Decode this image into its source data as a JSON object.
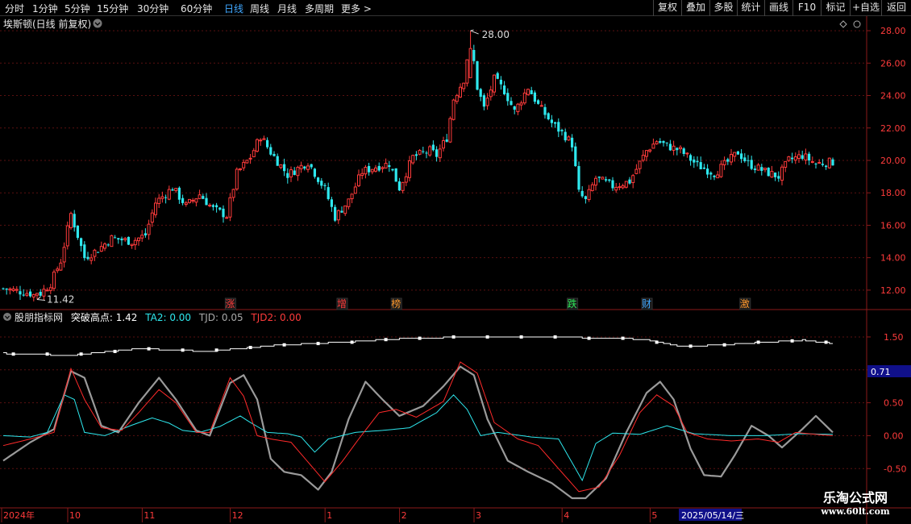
{
  "toolbar": {
    "timeframes": [
      "分时",
      "1分钟",
      "5分钟",
      "15分钟",
      "30分钟",
      "60分钟",
      "日线",
      "周线",
      "月线",
      "多周期",
      "更多 >"
    ],
    "active_timeframe": "日线",
    "right_buttons": [
      "复权",
      "叠加",
      "多股",
      "统计",
      "画线",
      "F10",
      "标记",
      "+自选",
      "返回"
    ]
  },
  "main_panel": {
    "title": "埃斯顿(日线 前复权)",
    "y_ticks": [
      "28.00",
      "26.00",
      "24.00",
      "22.00",
      "20.00",
      "18.00",
      "16.00",
      "14.00",
      "12.00"
    ],
    "high_label": "28.00",
    "low_label": "11.42",
    "event_markers": [
      {
        "text": "涨",
        "color": "#ff3b3b",
        "index": 67
      },
      {
        "text": "增",
        "color": "#ff3b3b",
        "index": 100
      },
      {
        "text": "榜",
        "color": "#ff9a2e",
        "index": 116
      },
      {
        "text": "跌",
        "color": "#2ee85a",
        "index": 168
      },
      {
        "text": "财",
        "color": "#3fa7ff",
        "index": 190
      },
      {
        "text": "激",
        "color": "#ff9a2e",
        "index": 219
      }
    ]
  },
  "indicator_panel": {
    "name": "股朋指标网",
    "legend": [
      {
        "label": "突破高点: 1.42",
        "color": "#ffffff"
      },
      {
        "label": "TA2: 0.00",
        "color": "#2ee8ee"
      },
      {
        "label": "TJD: 0.05",
        "color": "#aaaaaa"
      },
      {
        "label": "TJD2: 0.00",
        "color": "#ff3b3b"
      }
    ],
    "y_ticks": [
      "1.50",
      "1.00",
      "0.50",
      "0.00",
      "-0.50"
    ],
    "current_value": "0.71"
  },
  "x_axis": {
    "labels": [
      {
        "text": "2024年",
        "index": 0
      },
      {
        "text": "10",
        "index": 20
      },
      {
        "text": "11",
        "index": 42
      },
      {
        "text": "12",
        "index": 68
      },
      {
        "text": "1",
        "index": 96
      },
      {
        "text": "2",
        "index": 118
      },
      {
        "text": "3",
        "index": 140
      },
      {
        "text": "4",
        "index": 166
      },
      {
        "text": "5",
        "index": 192
      }
    ],
    "selected_date": "2025/05/14/三"
  },
  "watermark": {
    "line1": "乐淘公式网",
    "line2": "www.60lt.com"
  },
  "chart_data": {
    "type": "candlestick",
    "title": "埃斯顿(日线 前复权)",
    "price_range": [
      11.0,
      28.6
    ],
    "highest": 28.0,
    "lowest": 11.42,
    "close_keypoints": [
      [
        0,
        12.1
      ],
      [
        8,
        11.8
      ],
      [
        10,
        11.6
      ],
      [
        14,
        12.4
      ],
      [
        17,
        13.8
      ],
      [
        20,
        16.7
      ],
      [
        24,
        14.0
      ],
      [
        28,
        14.5
      ],
      [
        32,
        15.2
      ],
      [
        38,
        15.0
      ],
      [
        42,
        15.4
      ],
      [
        45,
        17.4
      ],
      [
        50,
        18.3
      ],
      [
        54,
        17.2
      ],
      [
        58,
        17.9
      ],
      [
        62,
        17.0
      ],
      [
        66,
        16.6
      ],
      [
        69,
        19.2
      ],
      [
        73,
        20.2
      ],
      [
        76,
        21.5
      ],
      [
        79,
        20.5
      ],
      [
        84,
        19.1
      ],
      [
        90,
        19.9
      ],
      [
        95,
        18.2
      ],
      [
        98,
        16.5
      ],
      [
        102,
        17.5
      ],
      [
        106,
        19.3
      ],
      [
        110,
        19.6
      ],
      [
        114,
        19.8
      ],
      [
        117,
        18.3
      ],
      [
        121,
        20.2
      ],
      [
        126,
        20.6
      ],
      [
        128,
        20.3
      ],
      [
        131,
        21.4
      ],
      [
        133,
        23.8
      ],
      [
        136,
        25.0
      ],
      [
        138,
        27.6
      ],
      [
        140,
        24.5
      ],
      [
        142,
        23.2
      ],
      [
        145,
        25.0
      ],
      [
        148,
        24.3
      ],
      [
        151,
        23.0
      ],
      [
        155,
        24.5
      ],
      [
        158,
        23.4
      ],
      [
        162,
        22.3
      ],
      [
        166,
        21.5
      ],
      [
        168,
        21.0
      ],
      [
        170,
        18.0
      ],
      [
        172,
        17.5
      ],
      [
        175,
        18.9
      ],
      [
        180,
        18.4
      ],
      [
        185,
        18.7
      ],
      [
        190,
        20.6
      ],
      [
        193,
        21.2
      ],
      [
        196,
        20.9
      ],
      [
        200,
        20.6
      ],
      [
        205,
        19.7
      ],
      [
        210,
        19.2
      ],
      [
        214,
        19.9
      ],
      [
        217,
        20.5
      ],
      [
        220,
        19.8
      ],
      [
        225,
        19.3
      ],
      [
        229,
        19.0
      ],
      [
        232,
        20.0
      ],
      [
        236,
        20.3
      ],
      [
        240,
        19.8
      ],
      [
        245,
        19.9
      ]
    ],
    "indicator": {
      "range": [
        -0.95,
        1.72
      ],
      "breakout_high_line": [
        [
          0,
          1.25
        ],
        [
          20,
          1.22
        ],
        [
          40,
          1.32
        ],
        [
          60,
          1.28
        ],
        [
          80,
          1.37
        ],
        [
          100,
          1.42
        ],
        [
          120,
          1.48
        ],
        [
          140,
          1.5
        ],
        [
          160,
          1.5
        ],
        [
          180,
          1.48
        ],
        [
          190,
          1.46
        ],
        [
          200,
          1.35
        ],
        [
          212,
          1.38
        ],
        [
          225,
          1.42
        ],
        [
          236,
          1.45
        ],
        [
          245,
          1.4
        ]
      ],
      "TA2": [
        [
          0,
          0.0
        ],
        [
          8,
          -0.02
        ],
        [
          13,
          0.05
        ],
        [
          18,
          0.62
        ],
        [
          21,
          0.55
        ],
        [
          24,
          0.05
        ],
        [
          30,
          0.0
        ],
        [
          38,
          0.16
        ],
        [
          44,
          0.27
        ],
        [
          49,
          0.19
        ],
        [
          53,
          0.08
        ],
        [
          58,
          0.05
        ],
        [
          64,
          0.14
        ],
        [
          70,
          0.3
        ],
        [
          73,
          0.2
        ],
        [
          78,
          0.05
        ],
        [
          84,
          0.03
        ],
        [
          88,
          -0.02
        ],
        [
          92,
          -0.25
        ],
        [
          96,
          -0.05
        ],
        [
          104,
          0.05
        ],
        [
          112,
          0.08
        ],
        [
          120,
          0.12
        ],
        [
          128,
          0.35
        ],
        [
          133,
          0.62
        ],
        [
          137,
          0.4
        ],
        [
          141,
          0.0
        ],
        [
          146,
          0.05
        ],
        [
          156,
          -0.02
        ],
        [
          164,
          -0.05
        ],
        [
          171,
          -0.68
        ],
        [
          175,
          -0.12
        ],
        [
          180,
          0.04
        ],
        [
          188,
          0.02
        ],
        [
          196,
          0.15
        ],
        [
          204,
          0.03
        ],
        [
          215,
          0.0
        ],
        [
          225,
          0.0
        ],
        [
          235,
          0.03
        ],
        [
          245,
          0.02
        ]
      ],
      "TJD": [
        [
          0,
          -0.38
        ],
        [
          8,
          -0.1
        ],
        [
          15,
          0.1
        ],
        [
          20,
          0.98
        ],
        [
          24,
          0.88
        ],
        [
          29,
          0.15
        ],
        [
          34,
          0.05
        ],
        [
          40,
          0.5
        ],
        [
          46,
          0.88
        ],
        [
          51,
          0.55
        ],
        [
          57,
          0.08
        ],
        [
          61,
          0.0
        ],
        [
          67,
          0.8
        ],
        [
          71,
          0.92
        ],
        [
          75,
          0.55
        ],
        [
          79,
          -0.35
        ],
        [
          83,
          -0.55
        ],
        [
          88,
          -0.6
        ],
        [
          93,
          -0.82
        ],
        [
          97,
          -0.55
        ],
        [
          102,
          0.25
        ],
        [
          107,
          0.82
        ],
        [
          112,
          0.55
        ],
        [
          117,
          0.3
        ],
        [
          124,
          0.45
        ],
        [
          130,
          0.75
        ],
        [
          135,
          1.05
        ],
        [
          139,
          0.92
        ],
        [
          143,
          0.25
        ],
        [
          149,
          -0.38
        ],
        [
          155,
          -0.55
        ],
        [
          162,
          -0.72
        ],
        [
          168,
          -0.95
        ],
        [
          172,
          -0.95
        ],
        [
          178,
          -0.65
        ],
        [
          184,
          0.05
        ],
        [
          190,
          0.65
        ],
        [
          194,
          0.82
        ],
        [
          198,
          0.55
        ],
        [
          203,
          -0.2
        ],
        [
          207,
          -0.6
        ],
        [
          212,
          -0.62
        ],
        [
          216,
          -0.3
        ],
        [
          221,
          0.15
        ],
        [
          226,
          0.0
        ],
        [
          230,
          -0.18
        ],
        [
          236,
          0.1
        ],
        [
          240,
          0.3
        ],
        [
          245,
          0.05
        ]
      ],
      "TJD2": [
        [
          0,
          -0.15
        ],
        [
          8,
          -0.05
        ],
        [
          15,
          0.05
        ],
        [
          20,
          1.02
        ],
        [
          24,
          0.55
        ],
        [
          29,
          0.12
        ],
        [
          35,
          0.08
        ],
        [
          40,
          0.35
        ],
        [
          46,
          0.7
        ],
        [
          51,
          0.5
        ],
        [
          57,
          0.05
        ],
        [
          61,
          0.05
        ],
        [
          67,
          0.88
        ],
        [
          71,
          0.6
        ],
        [
          75,
          0.0
        ],
        [
          79,
          -0.05
        ],
        [
          85,
          -0.1
        ],
        [
          90,
          -0.4
        ],
        [
          95,
          -0.7
        ],
        [
          100,
          -0.4
        ],
        [
          105,
          -0.05
        ],
        [
          111,
          0.35
        ],
        [
          116,
          0.4
        ],
        [
          122,
          0.28
        ],
        [
          130,
          0.52
        ],
        [
          135,
          1.12
        ],
        [
          140,
          0.95
        ],
        [
          145,
          0.2
        ],
        [
          152,
          -0.05
        ],
        [
          158,
          -0.15
        ],
        [
          164,
          -0.5
        ],
        [
          170,
          -0.85
        ],
        [
          176,
          -0.78
        ],
        [
          182,
          -0.3
        ],
        [
          188,
          0.35
        ],
        [
          193,
          0.62
        ],
        [
          198,
          0.45
        ],
        [
          202,
          0.05
        ],
        [
          208,
          -0.05
        ],
        [
          215,
          -0.08
        ],
        [
          223,
          -0.05
        ],
        [
          229,
          -0.1
        ],
        [
          234,
          0.05
        ],
        [
          240,
          0.02
        ],
        [
          245,
          0.0
        ]
      ]
    }
  }
}
